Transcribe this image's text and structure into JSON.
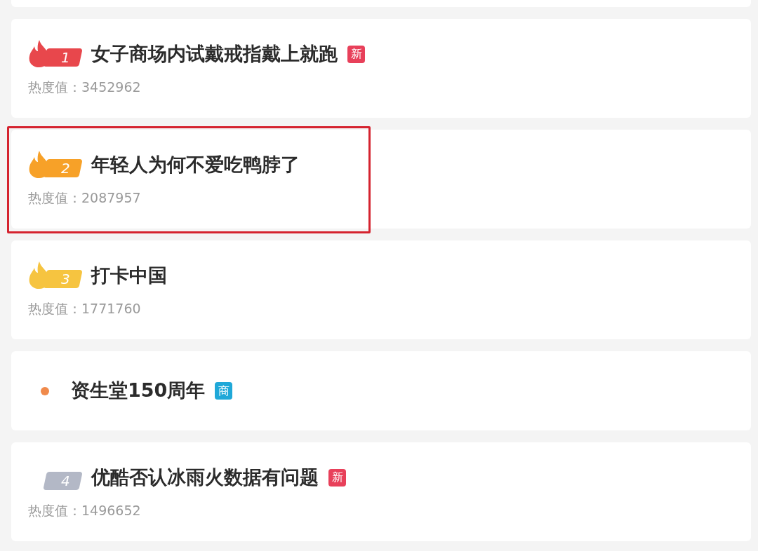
{
  "items": [
    {
      "kind": "ranked",
      "rank": "1",
      "flame": true,
      "color": "#e8474c",
      "title": "女子商场内试戴戒指戴上就跑",
      "tag": {
        "text": "新",
        "color": "#e8405a"
      },
      "heat": "热度值：3452962",
      "highlighted": false
    },
    {
      "kind": "ranked",
      "rank": "2",
      "flame": true,
      "color": "#f7a128",
      "title": "年轻人为何不爱吃鸭脖了",
      "heat": "热度值：2087957",
      "highlighted": true
    },
    {
      "kind": "ranked",
      "rank": "3",
      "flame": true,
      "color": "#f6c440",
      "title": "打卡中国",
      "heat": "热度值：1771760",
      "highlighted": false
    },
    {
      "kind": "promoted",
      "color": "#f08a4b",
      "title": "资生堂150周年",
      "tag": {
        "text": "商",
        "color": "#1fa8d8"
      },
      "highlighted": false
    },
    {
      "kind": "ranked",
      "rank": "4",
      "flame": false,
      "color": "#b3b8c6",
      "title": "优酷否认冰雨火数据有问题",
      "tag": {
        "text": "新",
        "color": "#e8405a"
      },
      "heat": "热度值：1496652",
      "highlighted": false
    }
  ]
}
